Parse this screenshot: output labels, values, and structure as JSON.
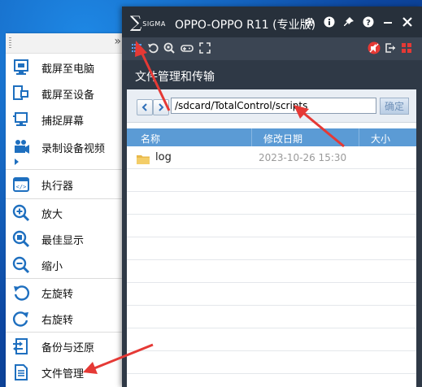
{
  "menu": {
    "items": [
      {
        "label": "截屏至电脑",
        "icon": "screenshot-to-pc-icon"
      },
      {
        "label": "截屏至设备",
        "icon": "screenshot-to-device-icon"
      },
      {
        "label": "捕捉屏幕",
        "icon": "capture-screen-icon"
      },
      {
        "label": "录制设备视频",
        "icon": "record-video-icon"
      },
      {
        "label": "执行器",
        "icon": "executor-icon"
      },
      {
        "label": "放大",
        "icon": "zoom-in-icon"
      },
      {
        "label": "最佳显示",
        "icon": "best-fit-icon"
      },
      {
        "label": "缩小",
        "icon": "zoom-out-icon"
      },
      {
        "label": "左旋转",
        "icon": "rotate-left-icon"
      },
      {
        "label": "右旋转",
        "icon": "rotate-right-icon"
      },
      {
        "label": "备份与还原",
        "icon": "backup-restore-icon"
      },
      {
        "label": "文件管理",
        "icon": "file-manager-icon"
      }
    ],
    "collapse_glyph": "»"
  },
  "window": {
    "logo_mark": "∑",
    "logo_text": "SIGMA",
    "title": "OPPO-OPPO R11 (专业版)",
    "section_title": "文件管理和传输"
  },
  "file_manager": {
    "path": "/sdcard/TotalControl/scripts",
    "confirm_label": "确定",
    "columns": {
      "name": "名称",
      "modified": "修改日期",
      "size": "大小"
    },
    "rows": [
      {
        "name": "log",
        "modified": "2023-10-26 15:30",
        "size": ""
      }
    ]
  },
  "colors": {
    "accent_blue": "#5b9bd5",
    "window_dark": "#2f3946",
    "annotation_red": "#e53935"
  }
}
